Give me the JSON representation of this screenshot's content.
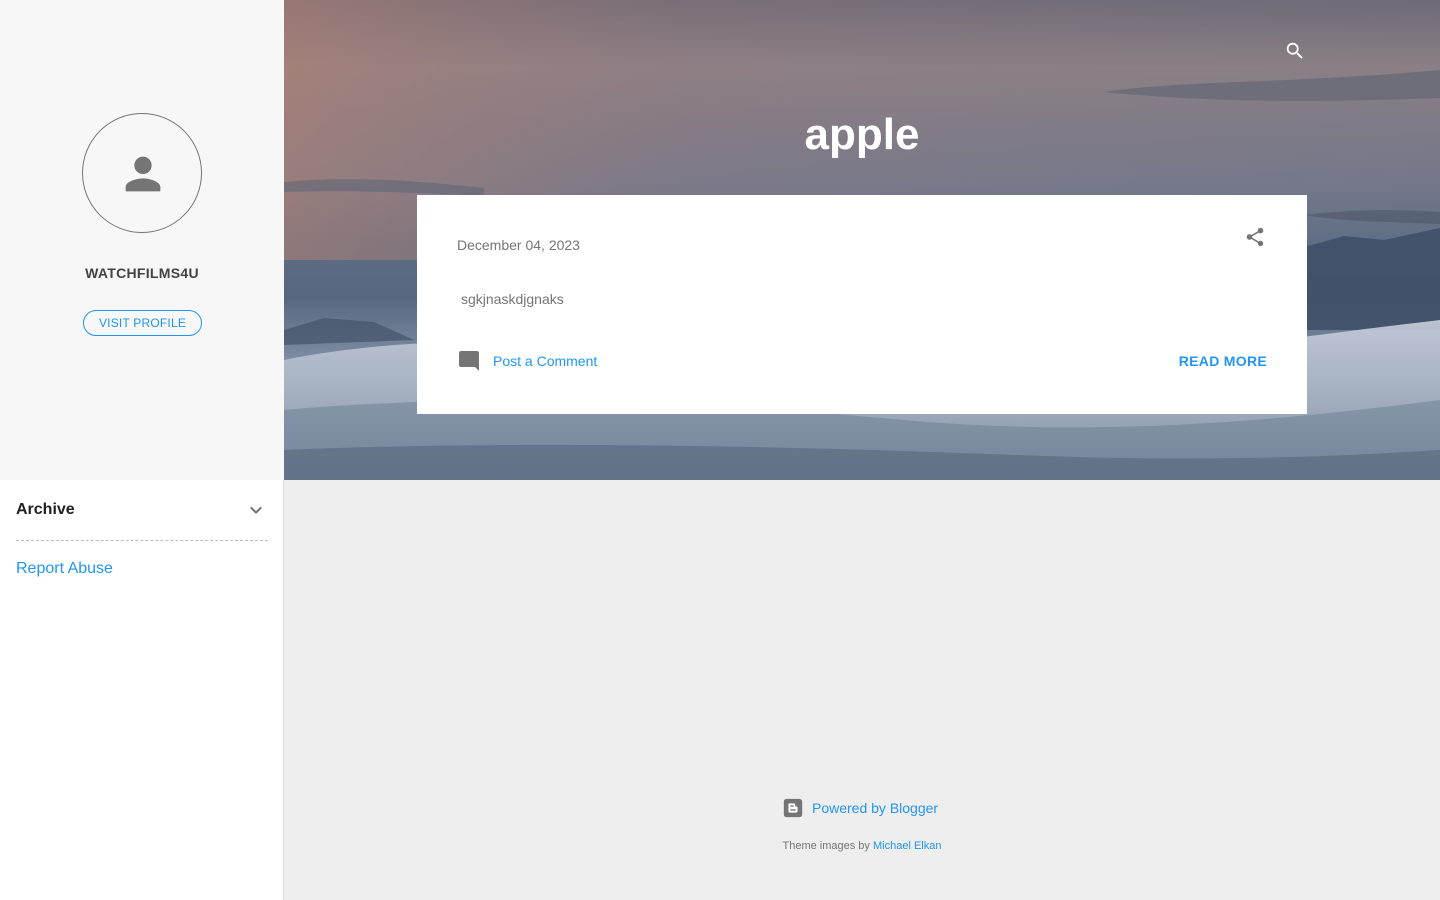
{
  "profile": {
    "name": "WATCHFILMS4U",
    "visit_label": "VISIT PROFILE"
  },
  "sidebar": {
    "archive_label": "Archive",
    "report_abuse_label": "Report Abuse"
  },
  "header": {
    "title": "apple"
  },
  "post": {
    "date": "December 04, 2023",
    "snippet": "sgkjnaskdjgnaks",
    "comment_label": "Post a Comment",
    "read_more_label": "READ MORE"
  },
  "footer": {
    "powered_label": "Powered by Blogger",
    "theme_prefix": "Theme images by",
    "theme_author": "Michael Elkan"
  },
  "colors": {
    "accent": "#2196f3",
    "sidebar_bg": "#f7f7f7",
    "page_bg": "#eeeeee"
  }
}
